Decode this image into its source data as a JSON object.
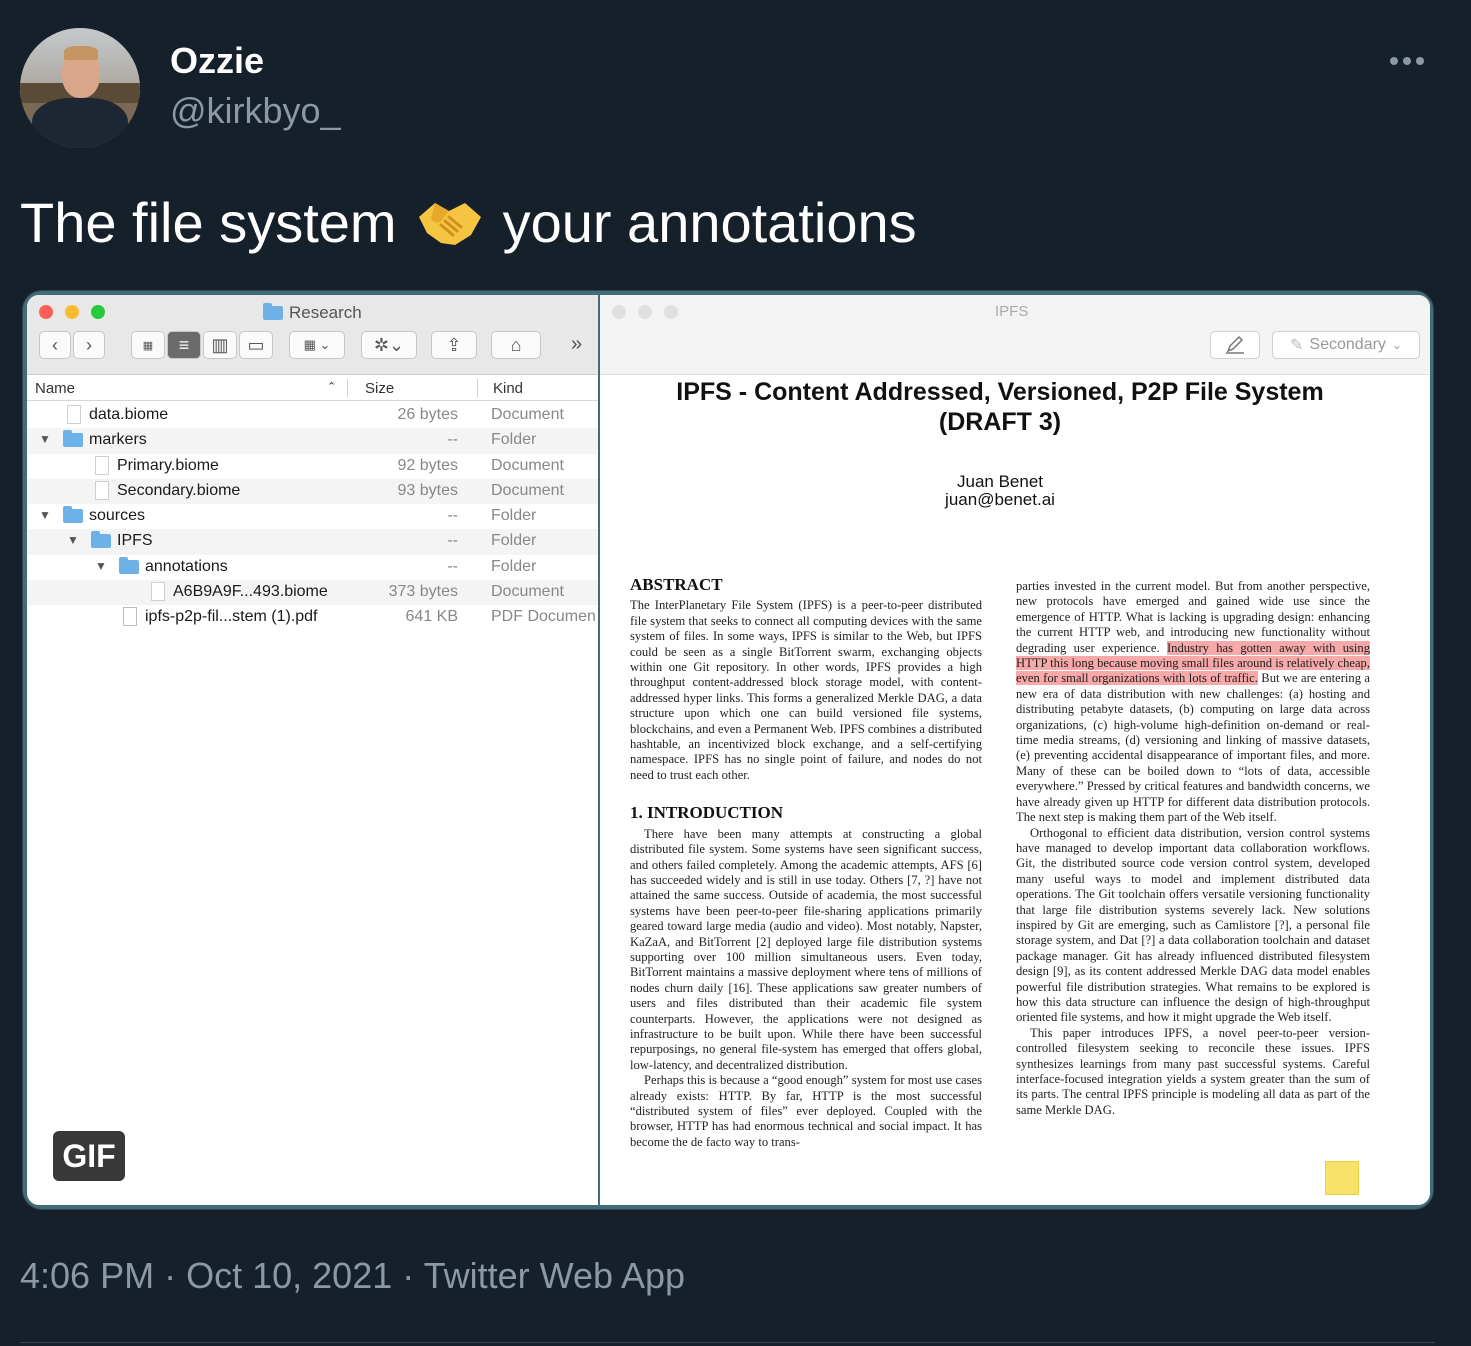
{
  "author": {
    "display_name": "Ozzie",
    "handle": "@kirkbyo_"
  },
  "tweet": {
    "text_before": "The file system",
    "emoji": "handshake",
    "text_after": "your annotations"
  },
  "media": {
    "badge": "GIF",
    "finder": {
      "window_title": "Research",
      "columns": {
        "name": "Name",
        "size": "Size",
        "kind": "Kind"
      },
      "rows": [
        {
          "name": "data.biome",
          "size": "26 bytes",
          "kind": "Document"
        },
        {
          "name": "markers",
          "size": "--",
          "kind": "Folder"
        },
        {
          "name": "Primary.biome",
          "size": "92 bytes",
          "kind": "Document"
        },
        {
          "name": "Secondary.biome",
          "size": "93 bytes",
          "kind": "Document"
        },
        {
          "name": "sources",
          "size": "--",
          "kind": "Folder"
        },
        {
          "name": "IPFS",
          "size": "--",
          "kind": "Folder"
        },
        {
          "name": "annotations",
          "size": "--",
          "kind": "Folder"
        },
        {
          "name": "A6B9A9F...493.biome",
          "size": "373 bytes",
          "kind": "Document"
        },
        {
          "name": "ipfs-p2p-fil...stem (1).pdf",
          "size": "641 KB",
          "kind": "PDF Documen"
        }
      ],
      "toolbar_more": "»"
    },
    "pdf": {
      "window_title": "IPFS",
      "color_button": "Secondary",
      "title_line1": "IPFS - Content Addressed, Versioned, P2P File System",
      "title_line2": "(DRAFT 3)",
      "author_name": "Juan Benet",
      "author_email": "juan@benet.ai",
      "abstract_heading": "ABSTRACT",
      "abstract_text": "The InterPlanetary File System (IPFS) is a peer-to-peer distributed file system that seeks to connect all computing devices with the same system of files. In some ways, IPFS is similar to the Web, but IPFS could be seen as a single BitTorrent swarm, exchanging objects within one Git repository. In other words, IPFS provides a high throughput content-addressed block storage model, with content-addressed hyper links. This forms a generalized Merkle DAG, a data structure upon which one can build versioned file systems, blockchains, and even a Permanent Web. IPFS combines a distributed hashtable, an incentivized block exchange, and a self-certifying namespace. IPFS has no single point of failure, and nodes do not need to trust each other.",
      "intro_heading": "1.   INTRODUCTION",
      "intro_p1": "There have been many attempts at constructing a global distributed file system. Some systems have seen significant success, and others failed completely. Among the academic attempts, AFS [6] has succeeded widely and is still in use today. Others [7, ?] have not attained the same success. Outside of academia, the most successful systems have been peer-to-peer file-sharing applications primarily geared toward large media (audio and video). Most notably, Napster, KaZaA, and BitTorrent [2] deployed large file distribution systems supporting over 100 million simultaneous users. Even today, BitTorrent maintains a massive deployment where tens of millions of nodes churn daily [16]. These applications saw greater numbers of users and files distributed than their academic file system counterparts. However, the applications were not designed as infrastructure to be built upon. While there have been successful repurposings, no general file-system has emerged that offers global, low-latency, and decentralized distribution.",
      "intro_p2": "Perhaps this is because a “good enough” system for most use cases already exists: HTTP. By far, HTTP is the most successful “distributed system of files” ever deployed. Coupled with the browser, HTTP has had enormous technical and social impact. It has become the de facto way to trans-",
      "right_p1_start": "parties invested in the current model. But from another perspective, new protocols have emerged and gained wide use since the emergence of HTTP. What is lacking is upgrading design: enhancing the current HTTP web, and introducing new functionality without degrading user experience.",
      "right_highlight": "Industry has gotten away with using HTTP this long because moving small files around is relatively cheap, even for small organizations with lots of traffic.",
      "right_p1_end": " But we are entering a new era of data distribution with new challenges: (a) hosting and distributing petabyte datasets, (b) computing on large data across organizations, (c) high-volume high-definition on-demand or real-time media streams, (d) versioning and linking of massive datasets, (e) preventing accidental disappearance of important files, and more. Many of these can be boiled down to “lots of data, accessible everywhere.” Pressed by critical features and bandwidth concerns, we have already given up HTTP for different data distribution protocols. The next step is making them part of the Web itself.",
      "right_p2": "Orthogonal to efficient data distribution, version control systems have managed to develop important data collaboration workflows. Git, the distributed source code version control system, developed many useful ways to model and implement distributed data operations. The Git toolchain offers versatile versioning functionality that large file distribution systems severely lack. New solutions inspired by Git are emerging, such as Camlistore [?], a personal file storage system, and Dat [?] a data collaboration toolchain and dataset package manager. Git has already influenced distributed filesystem design [9], as its content addressed Merkle DAG data model enables powerful file distribution strategies. What remains to be explored is how this data structure can influence the design of high-throughput oriented file systems, and how it might upgrade the Web itself.",
      "right_p3": "This paper introduces IPFS, a novel peer-to-peer version-controlled filesystem seeking to reconcile these issues. IPFS synthesizes learnings from many past successful systems. Careful interface-focused integration yields a system greater than the sum of its parts. The central IPFS principle is modeling all data as part of the same Merkle DAG."
    }
  },
  "meta": {
    "time": "4:06 PM",
    "date": "Oct 10, 2021",
    "source": "Twitter Web App",
    "separator": "·"
  }
}
